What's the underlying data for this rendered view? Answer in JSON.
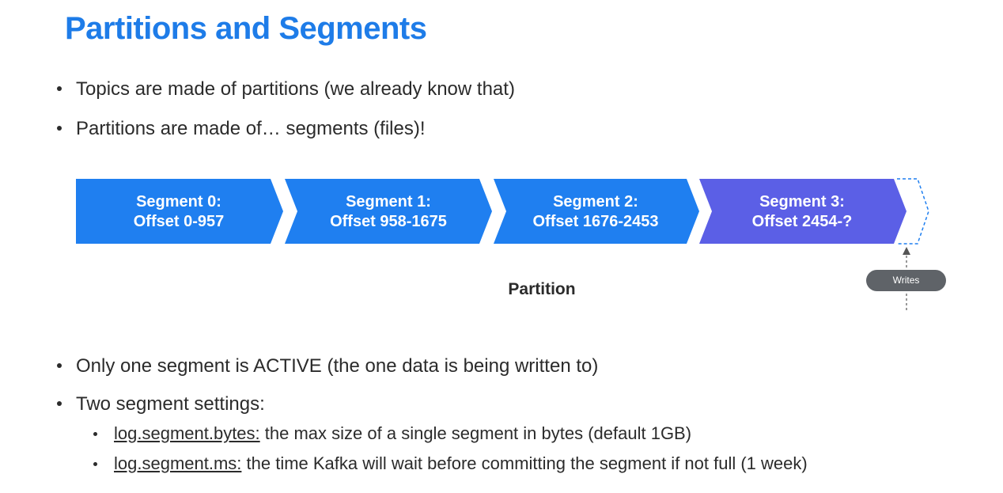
{
  "title": "Partitions and Segments",
  "top_bullets": [
    "Topics are made of partitions (we already know that)",
    "Partitions are made of… segments (files)!"
  ],
  "segments": [
    {
      "line1": "Segment 0:",
      "line2": "Offset 0-957",
      "color": "#1f7ff0"
    },
    {
      "line1": "Segment 1:",
      "line2": "Offset 958-1675",
      "color": "#1f7ff0"
    },
    {
      "line1": "Segment 2:",
      "line2": "Offset 1676-2453",
      "color": "#1f7ff0"
    },
    {
      "line1": "Segment 3:",
      "line2": "Offset 2454-?",
      "color": "#5b5fe6"
    }
  ],
  "partition_label": "Partition",
  "writes_label": "Writes",
  "bottom_bullets": [
    "Only one segment is ACTIVE (the one data is being written to)",
    "Two segment settings:"
  ],
  "settings": [
    {
      "name": "log.segment.bytes:",
      "desc": " the max size of a single segment in bytes (default 1GB)"
    },
    {
      "name": "log.segment.ms:",
      "desc": " the time Kafka will wait before committing the segment if not full (1 week)"
    }
  ]
}
